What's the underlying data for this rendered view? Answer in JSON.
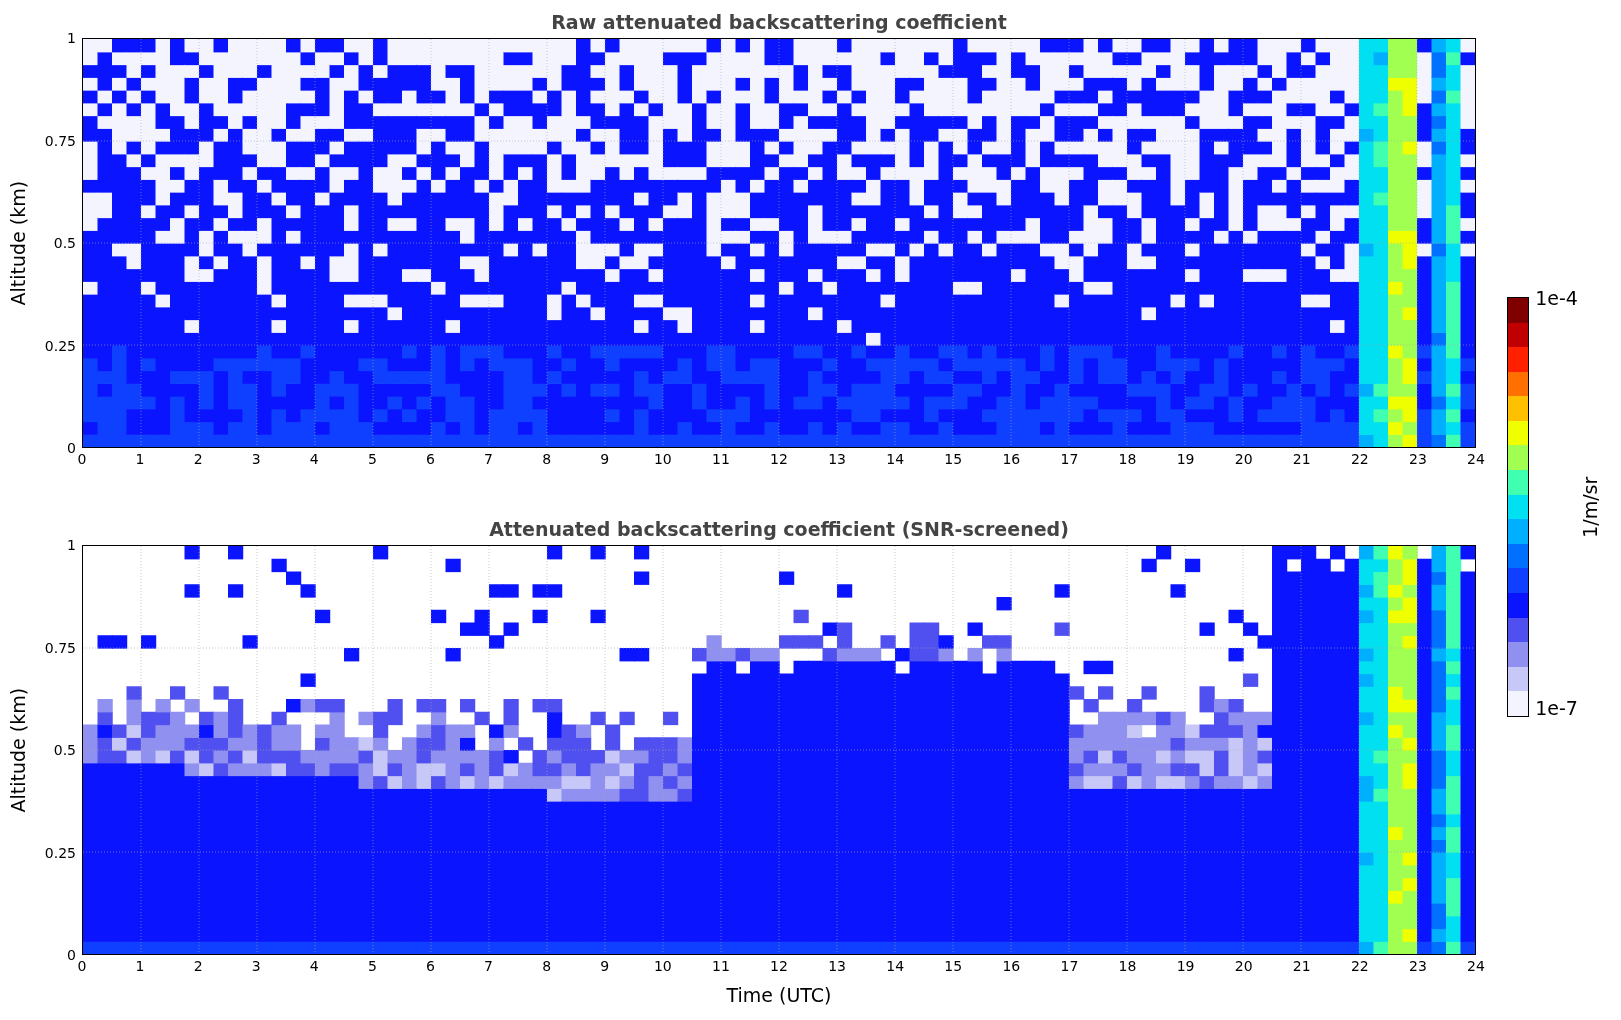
{
  "panels": [
    {
      "kind": "raw",
      "title": "Raw attenuated backscattering coefficient",
      "ylabel": "Altitude (km)",
      "yticks": [
        "1",
        "0.75",
        "0.5",
        "0.25",
        "0"
      ],
      "xticks": [
        "0",
        "1",
        "2",
        "3",
        "4",
        "5",
        "6",
        "7",
        "8",
        "9",
        "10",
        "11",
        "12",
        "13",
        "14",
        "15",
        "16",
        "17",
        "18",
        "19",
        "20",
        "21",
        "22",
        "23",
        "24"
      ]
    },
    {
      "kind": "screened",
      "title": "Attenuated backscattering coefficient (SNR-screened)",
      "ylabel": "Altitude (km)",
      "yticks": [
        "1",
        "0.75",
        "0.5",
        "0.25",
        "0"
      ],
      "xticks": [
        "0",
        "1",
        "2",
        "3",
        "4",
        "5",
        "6",
        "7",
        "8",
        "9",
        "10",
        "11",
        "12",
        "13",
        "14",
        "15",
        "16",
        "17",
        "18",
        "19",
        "20",
        "21",
        "22",
        "23",
        "24"
      ]
    }
  ],
  "xlabel": "Time (UTC)",
  "colorbar": {
    "max_label": "1e-4",
    "min_label": "1e-7",
    "label": "1/m/sr"
  }
}
